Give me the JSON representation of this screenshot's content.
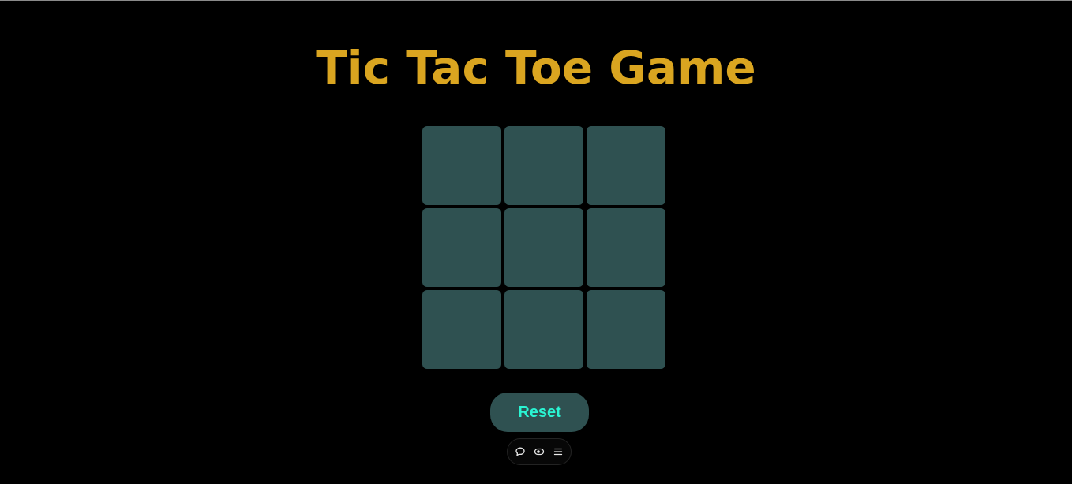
{
  "title": "Tic Tac Toe Game",
  "colors": {
    "background": "#000000",
    "title": "#DAA520",
    "cell": "#2F5151",
    "button_bg": "#2F5151",
    "button_text": "#2AF5D3",
    "icon": "#e8e8e8"
  },
  "board": {
    "cells": [
      "",
      "",
      "",
      "",
      "",
      "",
      "",
      "",
      ""
    ]
  },
  "reset_button": {
    "label": "Reset"
  },
  "toolbar": {
    "icons": [
      "chat-bubble-icon",
      "eye-toggle-icon",
      "menu-icon"
    ]
  }
}
